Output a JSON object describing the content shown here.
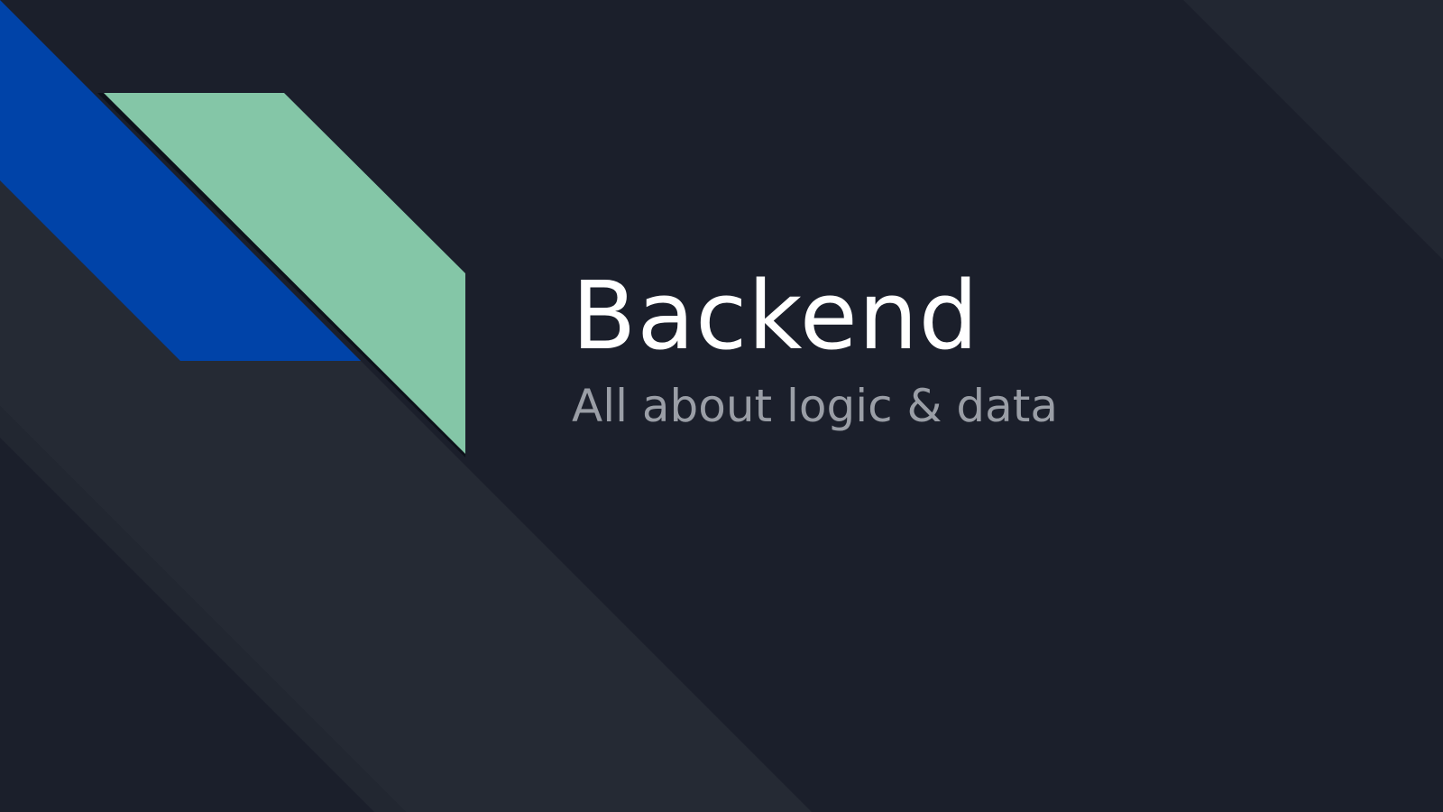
{
  "slide": {
    "title": "Backend",
    "subtitle": "All about logic & data"
  },
  "colors": {
    "background": "#1b1f2b",
    "stripe_dark": "#252a34",
    "accent_blue": "#0043a8",
    "accent_green": "#84c6a7",
    "title_text": "#ffffff",
    "subtitle_text": "#9a9ea6"
  }
}
